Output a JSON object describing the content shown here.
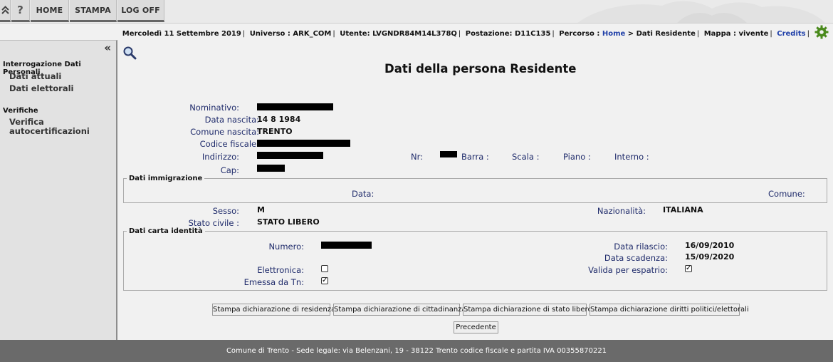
{
  "nav": {
    "buttons": [
      "HOME",
      "STAMPA",
      "LOG OFF"
    ],
    "icons": [
      "chevron-up-icon",
      "help-icon"
    ]
  },
  "infobar": {
    "date": "Mercoledì 11 Settembre 2019",
    "universo_label": "Universo :",
    "universo": "ARK_COM",
    "utente_label": "Utente:",
    "utente": "LVGNDR84M14L378Q",
    "postazione_label": "Postazione:",
    "postazione": "D11C135",
    "percorso_label": "Percorso :",
    "home_link": "Home",
    "percorso_rest": "> Dati Residente",
    "mappa_label": "Mappa :",
    "mappa": "vivente",
    "credits": "Credits"
  },
  "sidebar": {
    "section1": "Interrogazione Dati Personali",
    "items1": [
      "Dati attuali",
      "Dati elettorali"
    ],
    "section2": "Verifiche",
    "items2_line1": "Verifica",
    "items2_line2": "autocertificazioni"
  },
  "page": {
    "title": "Dati della persona Residente"
  },
  "persona": {
    "nominativo_label": "Nominativo:",
    "data_nascita_label": "Data nascita:",
    "data_nascita": "14 8 1984",
    "comune_nascita_label": "Comune nascita:",
    "comune_nascita": "TRENTO",
    "codice_fiscale_label": "Codice fiscale:",
    "indirizzo_label": "Indirizzo:",
    "nr_label": "Nr:",
    "barra_label": "Barra :",
    "scala_label": "Scala :",
    "piano_label": "Piano :",
    "interno_label": "Interno :",
    "cap_label": "Cap:"
  },
  "immigrazione": {
    "legend": "Dati immigrazione",
    "data_label": "Data:",
    "comune_label": "Comune:"
  },
  "stato": {
    "sesso_label": "Sesso:",
    "sesso": "M",
    "nazionalita_label": "Nazionalità:",
    "nazionalita": "ITALIANA",
    "stato_civile_label": "Stato civile :",
    "stato_civile": "STATO LIBERO"
  },
  "carta": {
    "legend": "Dati carta identità",
    "numero_label": "Numero:",
    "data_rilascio_label": "Data rilascio:",
    "data_rilascio": "16/09/2010",
    "data_scadenza_label": "Data scadenza:",
    "data_scadenza": "15/09/2020",
    "elettronica_label": "Elettronica:",
    "elettronica": false,
    "valida_espatrio_label": "Valida per espatrio:",
    "valida_espatrio": true,
    "emessa_tn_label": "Emessa da Tn:",
    "emessa_tn": true
  },
  "actions": {
    "btn1": "Stampa dichiarazione di residenza",
    "btn2": "Stampa dichiarazione di cittadinanza",
    "btn3": "Stampa dichiarazione di stato libero",
    "btn4": "Stampa dichiarazione diritti politici/elettorali",
    "precedente": "Precedente"
  },
  "footer": {
    "text": "Comune di Trento - Sede legale: via Belenzani, 19 - 38122 Trento codice fiscale e partita IVA 00355870221"
  }
}
